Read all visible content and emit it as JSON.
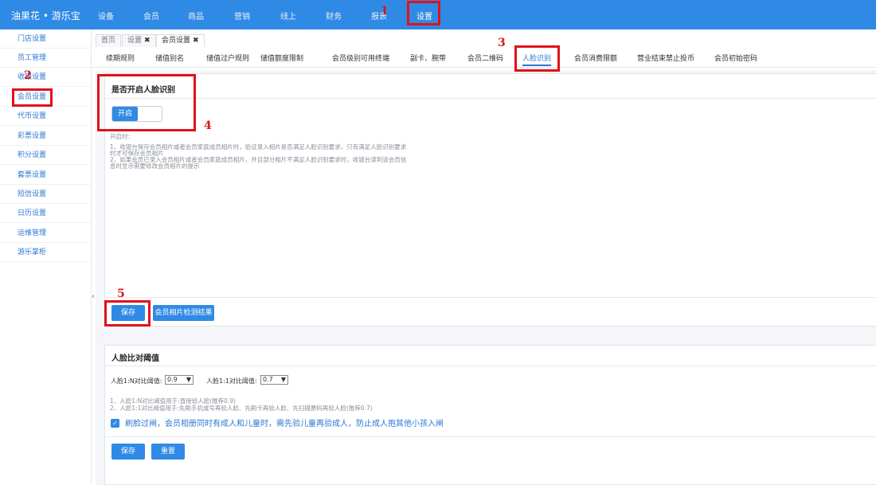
{
  "app": {
    "brand": "油果花 • 游乐宝"
  },
  "nav": [
    {
      "label": "设备"
    },
    {
      "label": "会员"
    },
    {
      "label": "商品"
    },
    {
      "label": "营销"
    },
    {
      "label": "线上"
    },
    {
      "label": "财务"
    },
    {
      "label": "报表"
    },
    {
      "label": "设置"
    }
  ],
  "sidebar": [
    {
      "label": "门店设置"
    },
    {
      "label": "员工管理"
    },
    {
      "label": "收银设置"
    },
    {
      "label": "会员设置"
    },
    {
      "label": "代币设置"
    },
    {
      "label": "彩票设置"
    },
    {
      "label": "积分设置"
    },
    {
      "label": "套票设置"
    },
    {
      "label": "短信设置"
    },
    {
      "label": "日历设置"
    },
    {
      "label": "运维管理"
    },
    {
      "label": "游乐掌柜"
    }
  ],
  "sidebar_collapse": "‹",
  "page_tabs": [
    {
      "label": "首页",
      "close": ""
    },
    {
      "label": "设置",
      "close": "✖"
    },
    {
      "label": "会员设置",
      "close": "✖"
    }
  ],
  "subtabs": [
    {
      "label": "续期规则"
    },
    {
      "label": "储值别名"
    },
    {
      "label": "储值过户规则"
    },
    {
      "label": "储值额度限制"
    },
    {
      "label": "会员级别可用终端"
    },
    {
      "label": "副卡、腕带"
    },
    {
      "label": "会员二维码"
    },
    {
      "label": "人脸识别"
    },
    {
      "label": "会员消费限额"
    },
    {
      "label": "营业结束禁止投币"
    },
    {
      "label": "会员初始密码"
    }
  ],
  "face_switch": {
    "title": "是否开启人脸识别",
    "toggle_label": "开启",
    "desc": [
      "开启时：",
      "1、收银台保存会员相片或者会员家庭成员相片时，验证录入相片是否满足人脸识别要求，只有满足人脸识别要求",
      "时才可保存会员相片",
      "2、如果会员已录入会员相片或者会员家庭成员相片，并且部分相片不满足人脸识别要求时，收银台读到该会员信",
      "息时显示需要修改会员相片的提示"
    ],
    "save_label": "保存",
    "check_label": "会员相片检测结果"
  },
  "threshold": {
    "title": "人脸比对阈值",
    "n_label": "人脸1:N对比阈值:",
    "n_value": "0.9",
    "one_label": "人脸1:1对比阈值:",
    "one_value": "0.7",
    "notes": [
      "1、人脸1:N对比阈值用于:直接验人脸(推荐0.9)",
      "2、人脸1:1对比阈值用于:先刷手机或号再验人脸、先刷卡再验人脸、先扫描票码再验人脸(推荐0.7)"
    ],
    "checkbox_label": "刷脸过闸，会员相册同时有成人和儿童时，需先验儿童再验成人，防止成人抱其他小孩入闸",
    "checkbox_mark": "✓",
    "save_label": "保存",
    "reset_label": "重置"
  },
  "annotations": [
    "1",
    "2",
    "3",
    "4",
    "5"
  ],
  "colors": {
    "topbar": "#2f8ae5",
    "accent": "#2a78d4",
    "annotation": "#e0121a"
  }
}
